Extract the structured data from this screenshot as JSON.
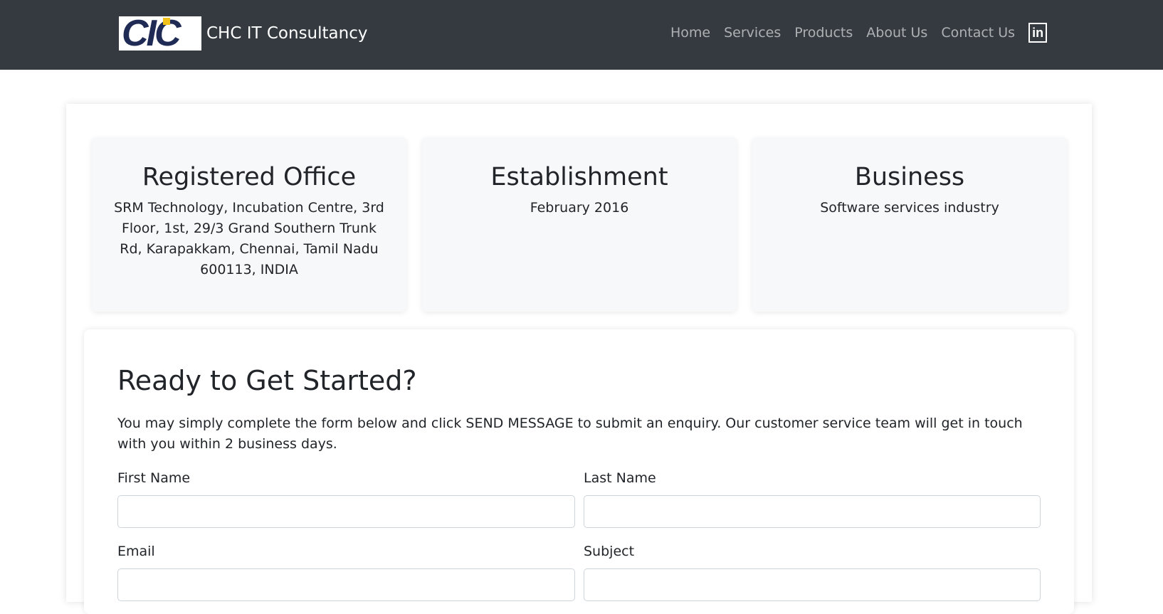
{
  "header": {
    "logo_text": "CIC",
    "brand_name": "CHC IT Consultancy",
    "nav": [
      {
        "label": "Home"
      },
      {
        "label": "Services"
      },
      {
        "label": "Products"
      },
      {
        "label": "About Us"
      },
      {
        "label": "Contact Us"
      }
    ],
    "linkedin_icon": "linkedin-icon",
    "linkedin_glyph": "in"
  },
  "info_cards": [
    {
      "title": "Registered Office",
      "text": "SRM Technology, Incubation Centre, 3rd Floor, 1st, 29/3 Grand Southern Trunk Rd, Karapakkam, Chennai, Tamil Nadu 600113, INDIA"
    },
    {
      "title": "Establishment",
      "text": "February 2016"
    },
    {
      "title": "Business",
      "text": "Software services industry"
    }
  ],
  "form": {
    "title": "Ready to Get Started?",
    "description": "You may simply complete the form below and click SEND MESSAGE to submit an enquiry. Our customer service team will get in touch with you within 2 business days.",
    "first_name_label": "First Name",
    "last_name_label": "Last Name",
    "email_label": "Email",
    "subject_label": "Subject",
    "first_name_value": "",
    "last_name_value": "",
    "email_value": "",
    "subject_value": ""
  },
  "colors": {
    "navbar_bg": "#343a40",
    "logo_navy": "#1f2a55",
    "logo_yellow": "#f3c21a",
    "card_bg": "#f7f8fa"
  }
}
